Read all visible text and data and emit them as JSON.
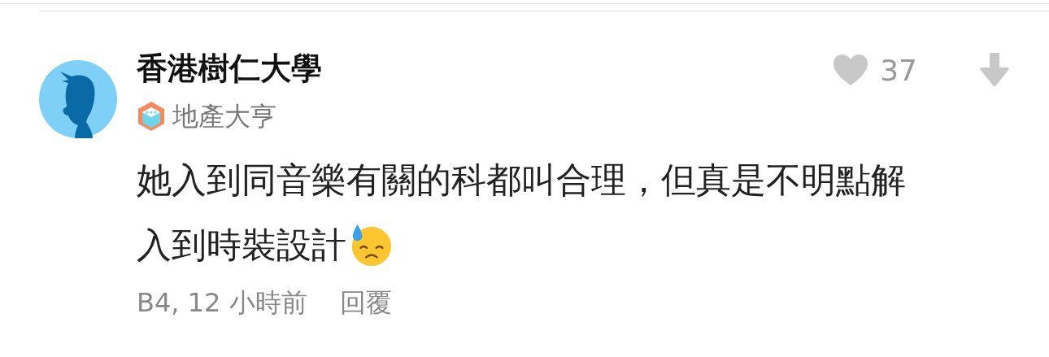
{
  "comment": {
    "author": "香港樹仁大學",
    "badge": "地產大亨",
    "like_count": "37",
    "body_lines": [
      "她入到同音樂有關的科都叫合理，但真是不明點解",
      "入到時裝設計"
    ],
    "meta": "B4, 12 小時前",
    "reply": "回覆"
  }
}
